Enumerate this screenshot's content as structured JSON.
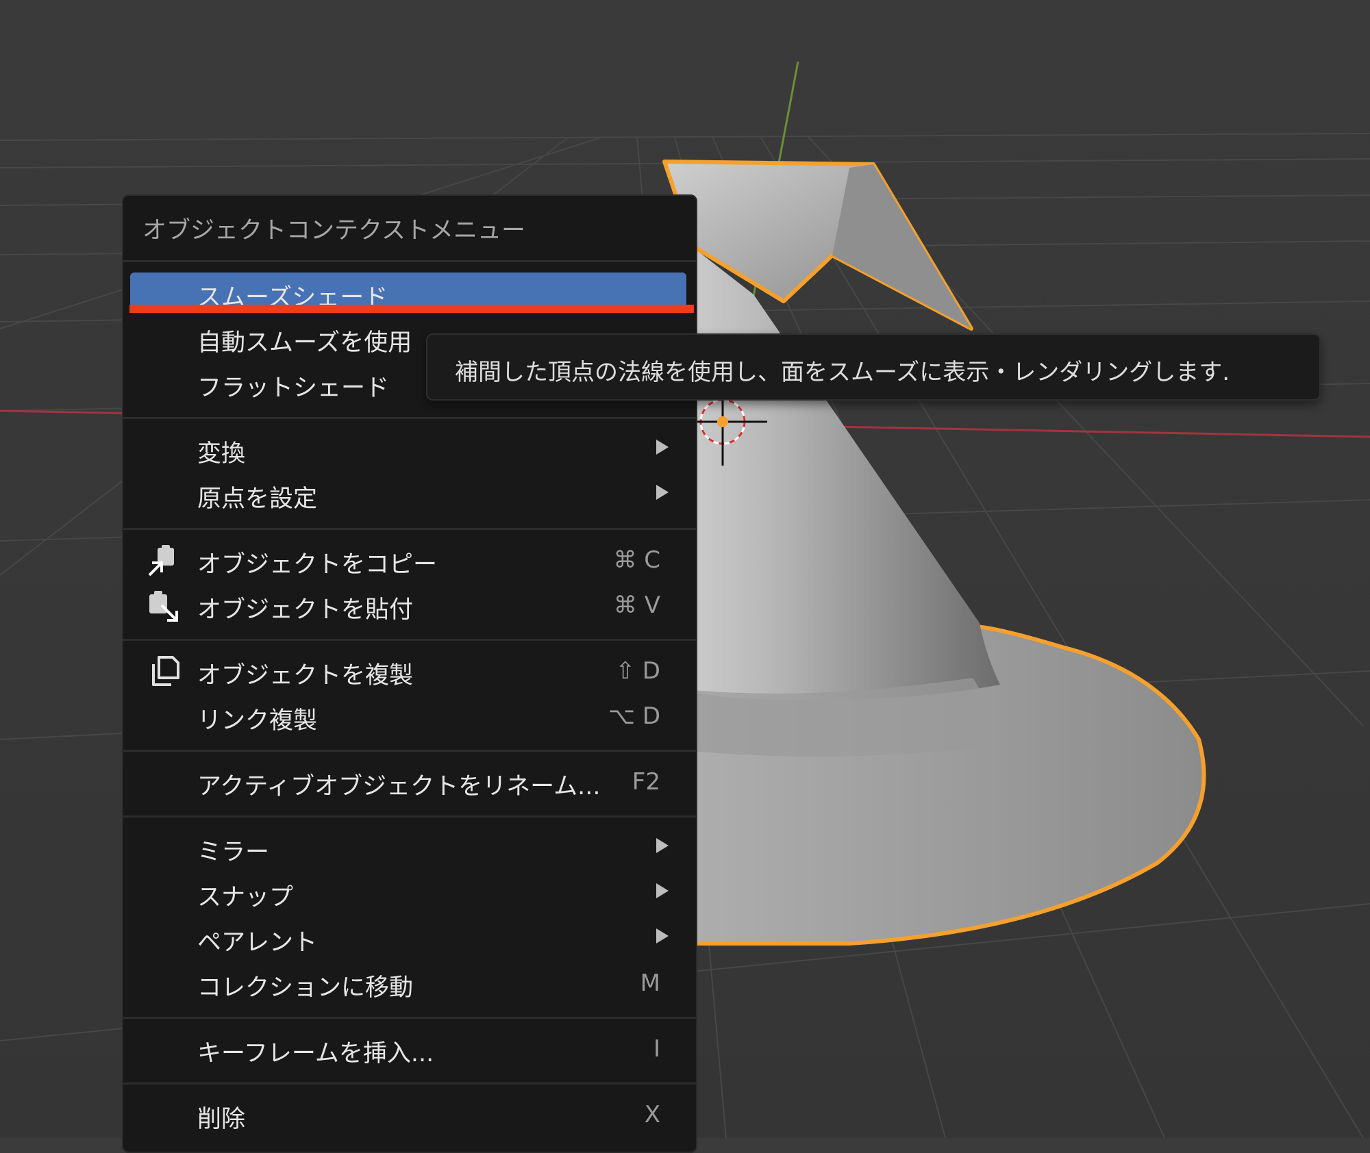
{
  "menu": {
    "title": "オブジェクトコンテクストメニュー",
    "items": [
      {
        "label": "スムーズシェード",
        "highlighted": true
      },
      {
        "label": "自動スムーズを使用"
      },
      {
        "label": "フラットシェード"
      },
      {
        "label": "変換",
        "submenu": true
      },
      {
        "label": "原点を設定",
        "submenu": true
      },
      {
        "label": "オブジェクトをコピー",
        "shortcut": "⌘ C",
        "icon": "copy-object-icon"
      },
      {
        "label": "オブジェクトを貼付",
        "shortcut": "⌘ V",
        "icon": "paste-object-icon"
      },
      {
        "label": "オブジェクトを複製",
        "shortcut": "⇧ D",
        "icon": "duplicate-icon"
      },
      {
        "label": "リンク複製",
        "shortcut": "⌥ D"
      },
      {
        "label": "アクティブオブジェクトをリネーム...",
        "shortcut": "F2"
      },
      {
        "label": "ミラー",
        "submenu": true
      },
      {
        "label": "スナップ",
        "submenu": true
      },
      {
        "label": "ペアレント",
        "submenu": true
      },
      {
        "label": "コレクションに移動",
        "shortcut": "M"
      },
      {
        "label": "キーフレームを挿入...",
        "shortcut": "I"
      },
      {
        "label": "削除",
        "shortcut": "X"
      }
    ]
  },
  "tooltip": {
    "text": "補間した頂点の法線を使用し、面をスムーズに表示・レンダリングします."
  },
  "colors": {
    "viewport_bg": "#3b3b3b",
    "menu_bg": "#181818",
    "highlight": "#4772b3",
    "selection_outline": "#f6a02d",
    "annotation_underline": "#f23a1f",
    "x_axis": "#a3343f",
    "y_axis": "#6a8f36"
  }
}
